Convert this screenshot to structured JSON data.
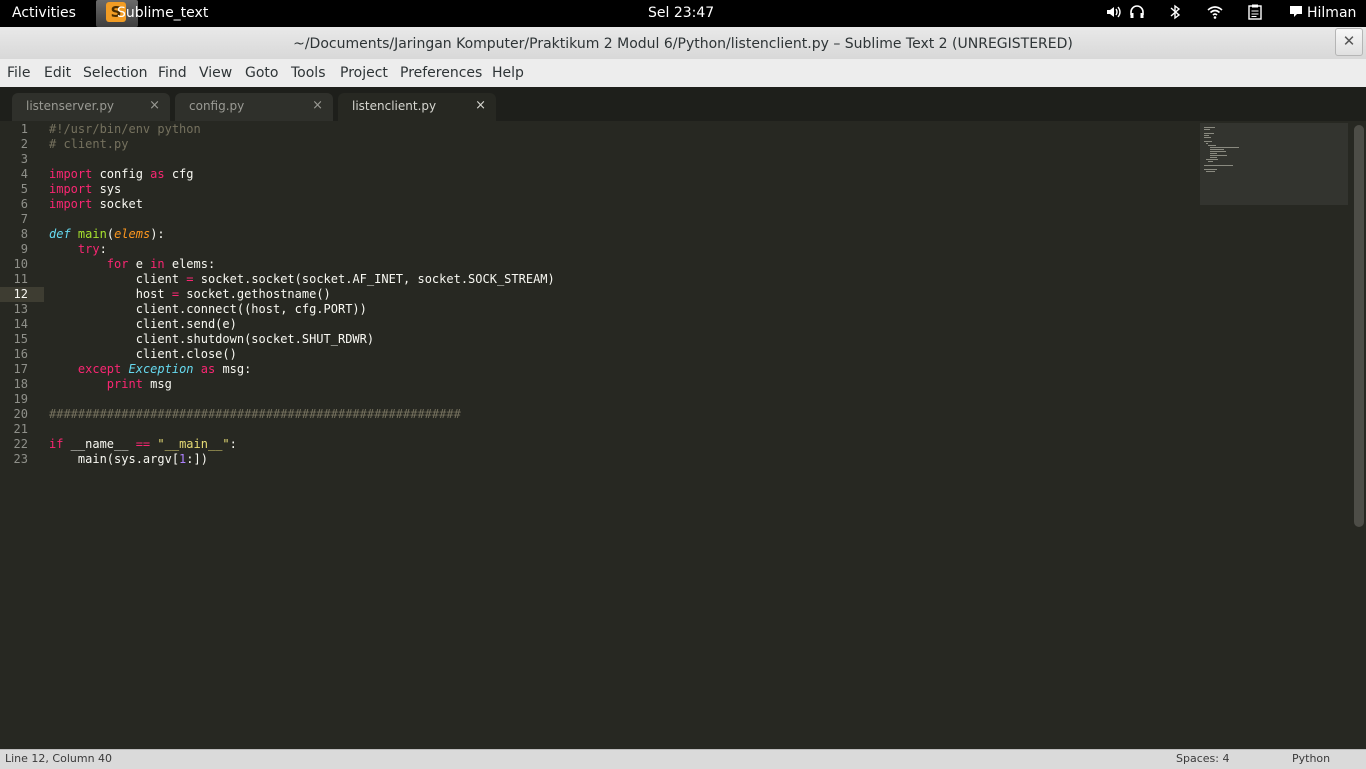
{
  "topbar": {
    "activities": "Activities",
    "app_name": "Sublime_text",
    "app_icon_letter": "S",
    "clock": "Sel 23:47",
    "user": "Hilman"
  },
  "window": {
    "title": "~/Documents/Jaringan Komputer/Praktikum 2 Modul 6/Python/listenclient.py – Sublime Text 2 (UNREGISTERED)",
    "close": "✕"
  },
  "menu": [
    "File",
    "Edit",
    "Selection",
    "Find",
    "View",
    "Goto",
    "Tools",
    "Project",
    "Preferences",
    "Help"
  ],
  "tabs": [
    {
      "label": "listenserver.py",
      "close": "×"
    },
    {
      "label": "config.py",
      "close": "×"
    },
    {
      "label": "listenclient.py",
      "close": "×",
      "active": true
    }
  ],
  "editor": {
    "current_line": 12,
    "line_numbers": [
      "1",
      "2",
      "3",
      "4",
      "5",
      "6",
      "7",
      "8",
      "9",
      "10",
      "11",
      "12",
      "13",
      "14",
      "15",
      "16",
      "17",
      "18",
      "19",
      "20",
      "21",
      "22",
      "23"
    ],
    "code": [
      "#!/usr/bin/env python",
      "# client.py",
      "",
      "import config as cfg",
      "import sys",
      "import socket",
      "",
      "def main(elems):",
      "    try:",
      "        for e in elems:",
      "            client = socket.socket(socket.AF_INET, socket.SOCK_STREAM)",
      "            host = socket.gethostname()",
      "            client.connect((host, cfg.PORT))",
      "            client.send(e)",
      "            client.shutdown(socket.SHUT_RDWR)",
      "            client.close()",
      "    except Exception as msg:",
      "        print msg",
      "",
      "#########################################################",
      "",
      "if __name__ == \"__main__\":",
      "    main(sys.argv[1:])"
    ]
  },
  "status": {
    "position": "Line 12, Column 40",
    "spaces": "Spaces: 4",
    "syntax": "Python"
  },
  "colors": {
    "editor_bg": "#272822",
    "keyword": "#f92672",
    "comment": "#75715e",
    "function": "#a6e22e",
    "string": "#e6db74"
  }
}
